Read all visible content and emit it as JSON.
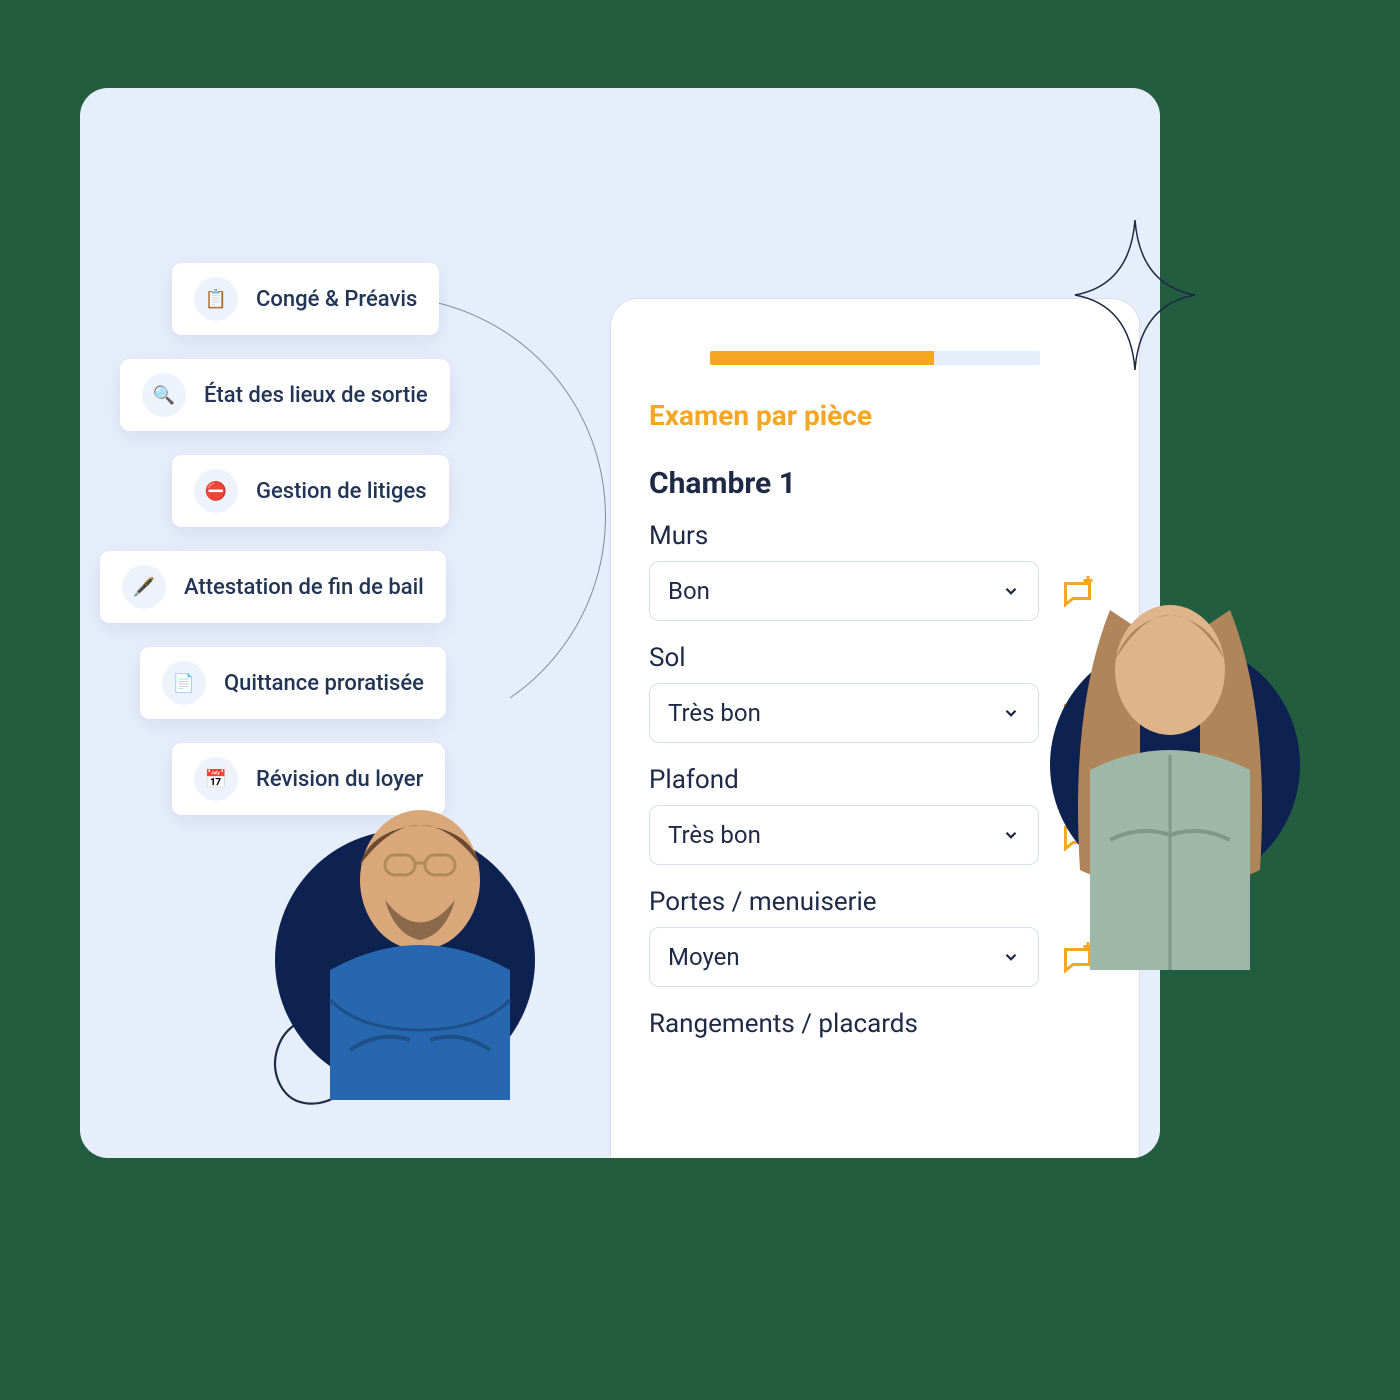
{
  "sidebar": {
    "items": [
      {
        "label": "Congé & Préavis",
        "icon": "📋"
      },
      {
        "label": "État des lieux de sortie",
        "icon": "🔍"
      },
      {
        "label": "Gestion de litiges",
        "icon": "⛔"
      },
      {
        "label": "Attestation de fin de bail",
        "icon": "🖋️"
      },
      {
        "label": "Quittance proratisée",
        "icon": "📄"
      },
      {
        "label": "Révision du loyer",
        "icon": "📅"
      }
    ]
  },
  "mobile": {
    "progress_percent": 68,
    "section_title": "Examen par pièce",
    "room_name": "Chambre 1",
    "fields": [
      {
        "label": "Murs",
        "value": "Bon"
      },
      {
        "label": "Sol",
        "value": "Très bon"
      },
      {
        "label": "Plafond",
        "value": "Très bon"
      },
      {
        "label": "Portes / menuiserie",
        "value": "Moyen"
      },
      {
        "label": "Rangements / placards",
        "value": ""
      }
    ]
  },
  "colors": {
    "accent": "#f5a623",
    "dark_navy": "#0d2251",
    "bg_light": "#e6eefc"
  }
}
